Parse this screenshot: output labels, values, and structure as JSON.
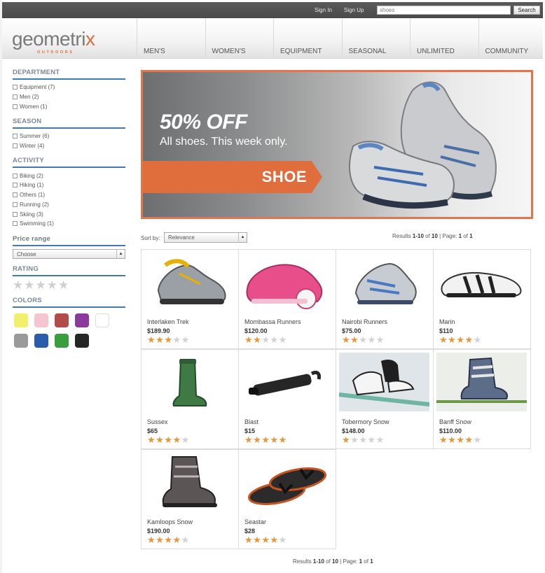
{
  "topbar": {
    "sign_in": "Sign In",
    "sign_up": "Sign Up",
    "search_value": "shoes",
    "search_button": "Search"
  },
  "brand": {
    "name_start": "geometri",
    "name_x": "x",
    "tagline": "OUTDOORS",
    "accent": "#e06d3c"
  },
  "nav": [
    "MEN'S",
    "WOMEN'S",
    "EQUIPMENT",
    "SEASONAL",
    "UNLIMITED",
    "COMMUNITY"
  ],
  "sidebar": {
    "department": {
      "title": "DEPARTMENT",
      "items": [
        "Equipment (7)",
        "Men (2)",
        "Women (1)"
      ]
    },
    "season": {
      "title": "SEASON",
      "items": [
        "Summer (6)",
        "Winter (4)"
      ]
    },
    "activity": {
      "title": "ACTIVITY",
      "items": [
        "Biking (2)",
        "Hiking (1)",
        "Others (1)",
        "Running (2)",
        "Skiing (3)",
        "Swimming (1)"
      ]
    },
    "price": {
      "title": "Price range",
      "selected": "Choose"
    },
    "rating": {
      "title": "RATING",
      "stars": 0
    },
    "colors": {
      "title": "COLORS",
      "swatches": [
        "#f2ef6a",
        "#f5c6d2",
        "#b44b4b",
        "#8b3b9c",
        "#ffffff",
        "#9a9a9a",
        "#2a5cad",
        "#3a9e3e",
        "#262626"
      ]
    }
  },
  "banner": {
    "headline": "50% OFF",
    "subline": "All shoes. This week only.",
    "ribbon": "SHOE"
  },
  "sort": {
    "label": "Sort by:",
    "selected": "Relevance"
  },
  "results": {
    "prefix": "Results ",
    "range": "1-10",
    "of_text": " of ",
    "total": "10",
    "page_text": " | Page: ",
    "page": "1",
    "page_of": " of ",
    "pages": "1"
  },
  "products": [
    {
      "name": "Interlaken Trek",
      "price": "$189.90",
      "rating": 3,
      "icon": "hiking-shoe-icon"
    },
    {
      "name": "Mombassa Runners",
      "price": "$120.00",
      "rating": 2,
      "icon": "pink-running-shoe-icon"
    },
    {
      "name": "Nairobi Runners",
      "price": "$75.00",
      "rating": 2,
      "icon": "running-shoe-icon"
    },
    {
      "name": "Marin",
      "price": "$110",
      "rating": 4,
      "icon": "cycling-shoe-icon"
    },
    {
      "name": "Sussex",
      "price": "$65",
      "rating": 4,
      "icon": "rubber-boot-icon"
    },
    {
      "name": "Blast",
      "price": "$15",
      "rating": 5,
      "icon": "bike-pump-icon"
    },
    {
      "name": "Tobermory Snow",
      "price": "$148.00",
      "rating": 1,
      "icon": "snowshoe-icon"
    },
    {
      "name": "Banff Snow",
      "price": "$110.00",
      "rating": 4,
      "icon": "ski-boot-icon"
    },
    {
      "name": "Kamloops Snow",
      "price": "$190.00",
      "rating": 4,
      "icon": "snowboard-boot-icon"
    },
    {
      "name": "Seastar",
      "price": "$28",
      "rating": 4,
      "icon": "flip-flop-icon"
    }
  ]
}
